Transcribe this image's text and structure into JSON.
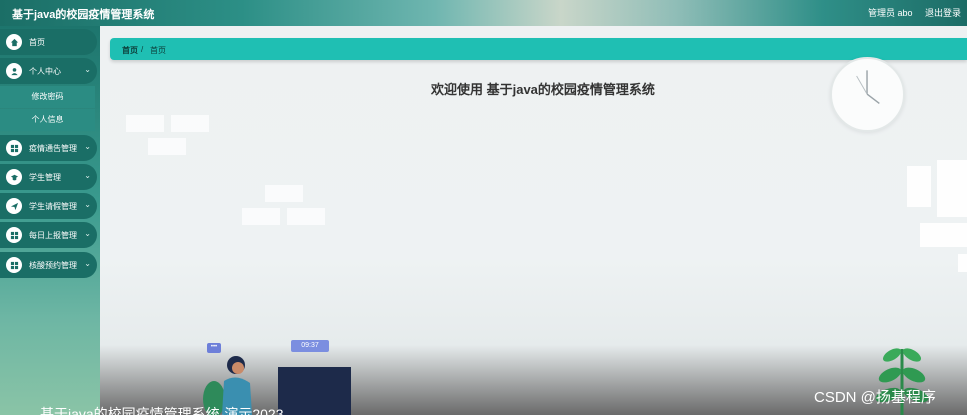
{
  "header": {
    "title": "基于java的校园疫情管理系统",
    "user_label": "管理员 abo",
    "logout_label": "退出登录"
  },
  "sidebar": {
    "items": [
      {
        "label": "首页",
        "icon": "home-icon"
      },
      {
        "label": "个人中心",
        "icon": "user-icon"
      },
      {
        "label": "疫情通告管理",
        "icon": "grid-icon"
      },
      {
        "label": "学生管理",
        "icon": "student-icon"
      },
      {
        "label": "学生请假管理",
        "icon": "send-icon"
      },
      {
        "label": "每日上报管理",
        "icon": "grid-icon"
      },
      {
        "label": "核酸预约管理",
        "icon": "grid-icon"
      }
    ],
    "subitems": [
      "修改密码",
      "个人信息"
    ]
  },
  "breadcrumb": {
    "home": "首页",
    "separator": "/",
    "current": "首页"
  },
  "main": {
    "welcome": "欢迎使用 基于java的校园疫情管理系统",
    "illustration_time": "09:37",
    "chat_dots": "•••"
  },
  "overlay": {
    "caption": "基于java的校园疫情管理系统-演示2023",
    "watermark": "CSDN @扬基程序"
  },
  "colors": {
    "accent": "#1fbfb3",
    "sidebar_item": "#1a6e66",
    "sidebar_subitem": "#2b8c83"
  }
}
